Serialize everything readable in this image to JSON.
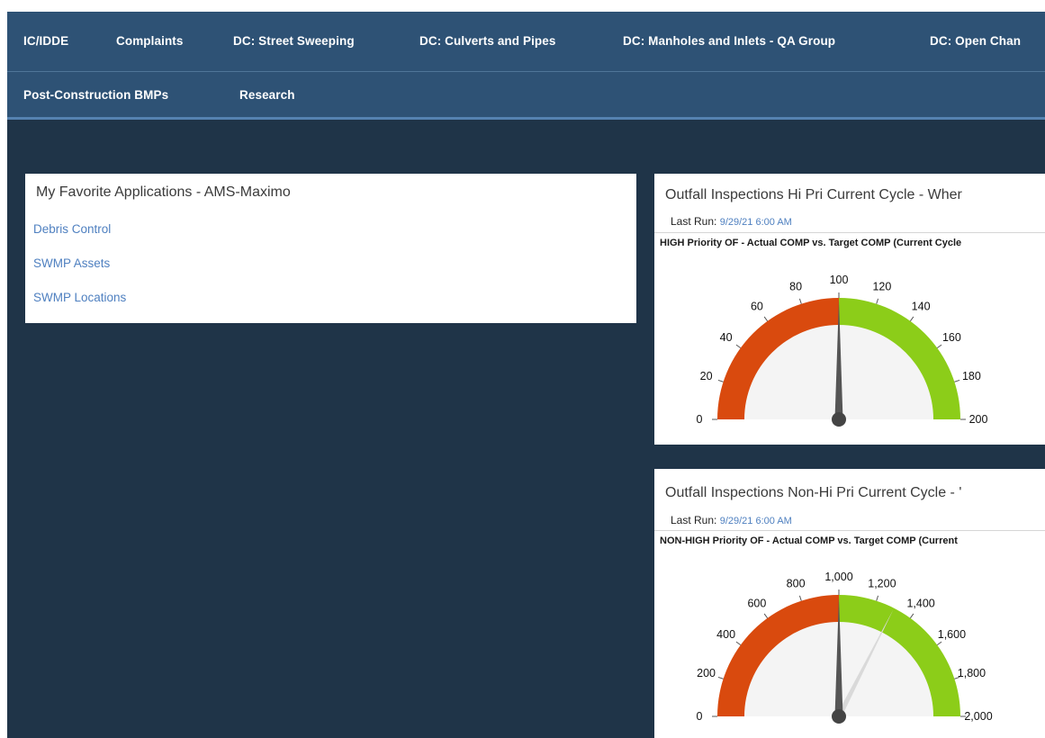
{
  "nav": {
    "row1": [
      "IC/IDDE",
      "Complaints",
      "DC: Street Sweeping",
      "DC: Culverts and Pipes",
      "DC: Manholes and Inlets - QA Group",
      "DC: Open Chan"
    ],
    "row2": [
      "Post-Construction BMPs",
      "Research"
    ]
  },
  "favorites": {
    "title": "My Favorite Applications - AMS-Maximo",
    "links": [
      "Debris Control",
      "SWMP Assets",
      "SWMP Locations"
    ]
  },
  "gauge1": {
    "title": "Outfall Inspections Hi Pri Current Cycle - Wher",
    "last_run_label": "Last Run:",
    "last_run_value": "9/29/21 6:00 AM",
    "subtitle": "HIGH Priority OF - Actual COMP vs. Target COMP (Current Cycle",
    "ticks": [
      "0",
      "20",
      "40",
      "60",
      "80",
      "100",
      "120",
      "140",
      "160",
      "180",
      "200"
    ]
  },
  "gauge2": {
    "title": "Outfall Inspections Non-Hi Pri Current Cycle - '",
    "last_run_label": "Last Run:",
    "last_run_value": "9/29/21 6:00 AM",
    "subtitle": "NON-HIGH Priority OF - Actual COMP vs. Target COMP (Current",
    "ticks": [
      "0",
      "200",
      "400",
      "600",
      "800",
      "1,000",
      "1,200",
      "1,400",
      "1,600",
      "1,800",
      "2,000"
    ]
  },
  "chart_data": [
    {
      "type": "gauge",
      "min": 0,
      "max": 200,
      "bands": [
        {
          "from": 0,
          "to": 100,
          "color": "#d94a0e"
        },
        {
          "from": 100,
          "to": 200,
          "color": "#8ccd19"
        }
      ],
      "needle_value": 100
    },
    {
      "type": "gauge",
      "min": 0,
      "max": 2000,
      "bands": [
        {
          "from": 0,
          "to": 1000,
          "color": "#d94a0e"
        },
        {
          "from": 1000,
          "to": 2000,
          "color": "#8ccd19"
        }
      ],
      "needle_value": 1000,
      "secondary_needle_value": 1300
    }
  ]
}
